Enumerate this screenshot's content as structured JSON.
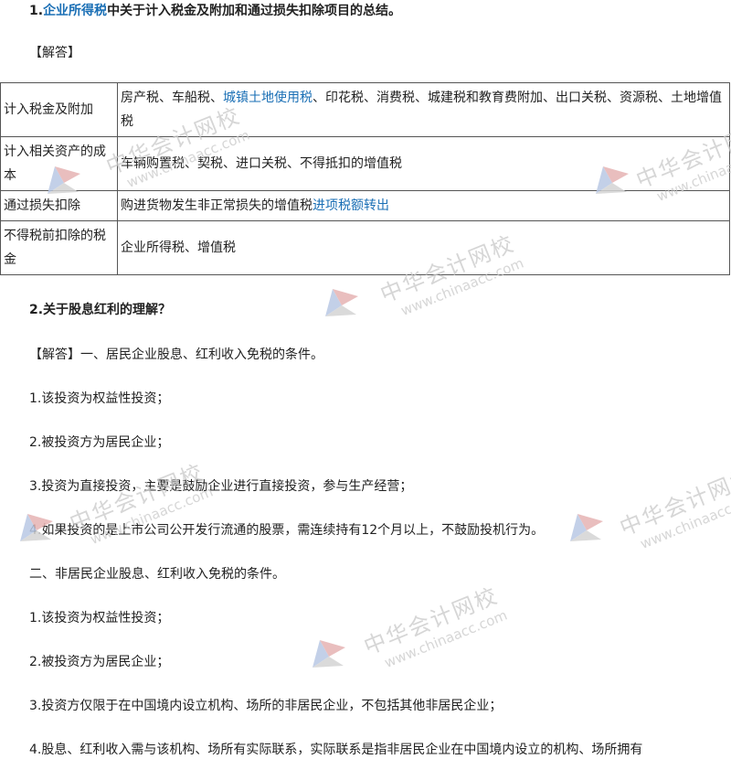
{
  "q1": {
    "num": "1.",
    "link_text": "企业所得税",
    "rest": "中关于计入税金及附加和通过损失扣除项目的总结。"
  },
  "answer_label": "【解答】",
  "table": {
    "rows": [
      {
        "label": "计入税金及附加",
        "before": "房产税、车船税、",
        "link": "城镇土地使用税",
        "after": "、印花税、消费税、城建税和教育费附加、出口关税、资源税、土地增值税"
      },
      {
        "label": "计入相关资产的成本",
        "before": "车辆购置税、契税、进口关税、不得抵扣的增值税",
        "link": "",
        "after": ""
      },
      {
        "label": "通过损失扣除",
        "before": "购进货物发生非正常损失的增值税",
        "link": "进项税额转出",
        "after": ""
      },
      {
        "label": "不得税前扣除的税金",
        "before": "企业所得税、增值税",
        "link": "",
        "after": ""
      }
    ]
  },
  "q2": {
    "title": "2.关于股息红利的理解？",
    "lines": [
      "【解答】一、居民企业股息、红利收入免税的条件。",
      "1.该投资为权益性投资；",
      "2.被投资方为居民企业；",
      "3.投资为直接投资，主要是鼓励企业进行直接投资，参与生产经营；",
      "4.如果投资的是上市公司公开发行流通的股票，需连续持有12个月以上，不鼓励投机行为。",
      "二、非居民企业股息、红利收入免税的条件。",
      "1.该投资为权益性投资；",
      "2.被投资方为居民企业；",
      "3.投资方仅限于在中国境内设立机构、场所的非居民企业，不包括其他非居民企业；",
      "4.股息、红利收入需与该机构、场所有实际联系，实际联系是指非居民企业在中国境内设立的机构、场所拥有"
    ]
  },
  "watermark": {
    "cn": "中华会计网校",
    "url": "www.chinaacc.com"
  },
  "colors": {
    "link": "#1a6fb5",
    "border": "#555555",
    "watermark": "#c9c9c9"
  }
}
